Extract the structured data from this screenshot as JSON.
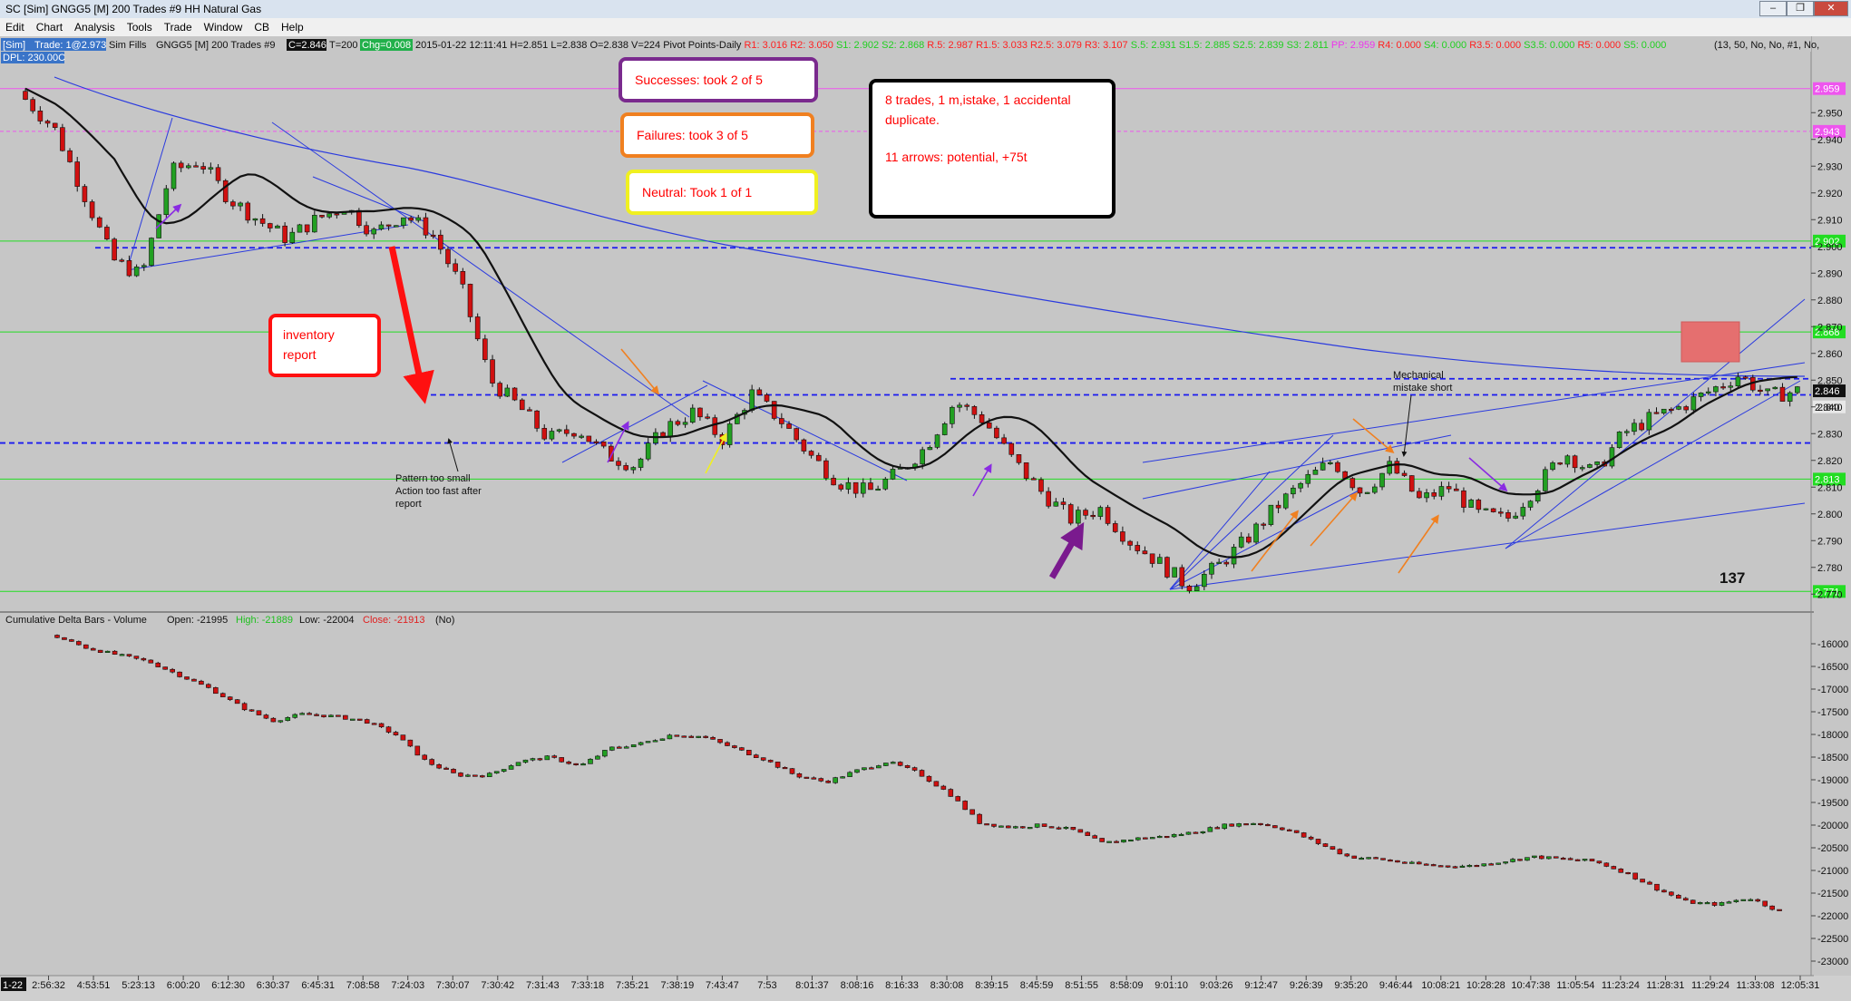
{
  "window": {
    "title": "SC [Sim] GNGG5 [M]  200 Trades  #9  HH Natural Gas",
    "buttons": [
      "–",
      "❐",
      "✕"
    ]
  },
  "menu": [
    "Edit",
    "Chart",
    "Analysis",
    "Tools",
    "Trade",
    "Window",
    "CB",
    "Help"
  ],
  "infobar": {
    "sim_tag": "[Sim]",
    "trade_tag": "Trade: 1@2.973",
    "fills": "Sim Fills",
    "symbol": "GNGG5 [M]  200 Trades  #9",
    "last_box": "C=2.846",
    "trades": "T=200",
    "chg_box": "Chg=0.008",
    "ohlc": "2015-01-22 12:11:41  H=2.851  L=2.838  O=2.838  V=224  Pivot Points-Daily",
    "pivots_red": "R1: 3.016  R2: 3.050  ",
    "pivots_green1": "S1: 2.902  S2: 2.868  ",
    "pivots_red2": "R.5: 2.987  R1.5: 3.033  R2.5: 3.079  R3: 3.107  ",
    "pivots_green2": "S.5: 2.931  S1.5: 2.885  S2.5: 2.839  S3: 2.811  ",
    "pp": "PP: 2.959  ",
    "pivots_red3": "R4: 0.000  ",
    "pivots_green3": "S4: 0.000  ",
    "pivots_red4": "R3.5: 0.000  ",
    "pivots_green4": "S3.5: 0.000  ",
    "pivots_red5": "R5: 0.000  ",
    "pivots_green5": "S5: 0.000",
    "study_params": "(13, 50, No, No, #1, No,",
    "dpl": "DPL: 230.00C"
  },
  "lower_header": {
    "name": "Cumulative Delta Bars - Volume",
    "open": "Open: -21995",
    "high": "High: -21889",
    "low": "Low: -22004",
    "close": "Close: -21913",
    "flag": "(No)"
  },
  "notes": {
    "successes": "Successes: took 2 of 5",
    "failures": "Failures: took 3 of 5",
    "neutral": "Neutral: Took 1 of 1",
    "summary_line1": "8 trades, 1 m,istake, 1 accidental",
    "summary_line2": "duplicate.",
    "summary_line3": "11 arrows: potential,  +75t",
    "inventory_line1": "inventory",
    "inventory_line2": "report",
    "pattern_line1": "Pattern too small",
    "pattern_line2": "Action too fast after",
    "pattern_line3": "report",
    "mechanical_line1": "Mechanical",
    "mechanical_line2": "mistake short",
    "count": "137"
  },
  "colors": {
    "background": "#c6c6c6",
    "up_bar": "#22a022",
    "down_bar": "#d01010",
    "pivot_green": "#22dd22",
    "dashed_level": "#1a1af0",
    "magenta_level": "#ee55ee",
    "trendline": "#2a3adf",
    "successes_border": "#7a2a8e",
    "failures_border": "#f08020",
    "neutral_border": "#f0f020",
    "inventory_border": "#ff1010",
    "summary_border": "#000000",
    "note_text": "#ff0000"
  },
  "chart_data": {
    "type": "candlestick",
    "price": {
      "ylim": [
        2.765,
        2.965
      ],
      "y_ticks": [
        2.95,
        2.94,
        2.93,
        2.92,
        2.91,
        2.9,
        2.89,
        2.88,
        2.87,
        2.86,
        2.85,
        2.84,
        2.83,
        2.82,
        2.81,
        2.8,
        2.79,
        2.78,
        2.77
      ],
      "y_tick_labels": [
        "2.950",
        "2.940",
        "2.930",
        "2.920",
        "2.910",
        "2.900",
        "2.890",
        "2.880",
        "2.870",
        "2.860",
        "2.850",
        "2.840",
        "2.830",
        "2.820",
        "2.810",
        "2.800",
        "2.790",
        "2.780",
        "2.770"
      ],
      "close_keypoints": [
        2.955,
        2.944,
        2.92,
        2.895,
        2.889,
        2.928,
        2.932,
        2.918,
        2.91,
        2.903,
        2.91,
        2.915,
        2.905,
        2.912,
        2.905,
        2.885,
        2.85,
        2.84,
        2.828,
        2.832,
        2.822,
        2.818,
        2.832,
        2.838,
        2.828,
        2.845,
        2.835,
        2.822,
        2.812,
        2.808,
        2.815,
        2.825,
        2.842,
        2.835,
        2.82,
        2.808,
        2.798,
        2.802,
        2.79,
        2.782,
        2.773,
        2.78,
        2.79,
        2.802,
        2.812,
        2.82,
        2.808,
        2.818,
        2.805,
        2.81,
        2.8,
        2.798,
        2.81,
        2.823,
        2.815,
        2.83,
        2.836,
        2.84,
        2.846,
        2.852,
        2.844,
        2.846
      ],
      "levels": [
        {
          "name": "PP",
          "value": 2.959,
          "label": "2.959",
          "style": "magenta"
        },
        {
          "name": "R.5-area",
          "value": 2.943,
          "label": "2.943",
          "style": "magenta-dashed"
        },
        {
          "name": "S1",
          "value": 2.902,
          "label": "2.902",
          "style": "green"
        },
        {
          "name": "S1.5",
          "value": 2.868,
          "label": "2.868",
          "style": "green"
        },
        {
          "name": "S2",
          "value": 2.813,
          "label": "2.813",
          "style": "green"
        },
        {
          "name": "S3",
          "value": 2.771,
          "label": "2.771",
          "style": "green"
        },
        {
          "name": "dash1",
          "value": 2.8995,
          "label": "",
          "style": "dashed"
        },
        {
          "name": "dash2",
          "value": 2.8505,
          "label": "",
          "style": "dashed"
        },
        {
          "name": "dash3",
          "value": 2.8445,
          "label": "",
          "style": "dashed"
        },
        {
          "name": "dash4",
          "value": 2.8265,
          "label": "",
          "style": "dashed"
        }
      ],
      "last_price": {
        "value": 2.846,
        "label": "2.846"
      },
      "prev_close": {
        "value": 2.84,
        "label": "2.840"
      }
    },
    "delta": {
      "ylim": [
        -23200,
        -15700
      ],
      "y_ticks": [
        -16000,
        -16500,
        -17000,
        -17500,
        -18000,
        -18500,
        -19000,
        -19500,
        -20000,
        -20500,
        -21000,
        -21500,
        -22000,
        -22500,
        -23000
      ],
      "y_tick_labels": [
        "-16000",
        "-16500",
        "-17000",
        "-17500",
        "-18000",
        "-18500",
        "-19000",
        "-19500",
        "-20000",
        "-20500",
        "-21000",
        "-21500",
        "-22000",
        "-22500",
        "-23000"
      ],
      "close_keypoints": [
        -15850,
        -16100,
        -16250,
        -16400,
        -16700,
        -17000,
        -17400,
        -17700,
        -17550,
        -17600,
        -17700,
        -18000,
        -18600,
        -18900,
        -18900,
        -18600,
        -18500,
        -18700,
        -18300,
        -18200,
        -18000,
        -18050,
        -18300,
        -18550,
        -18900,
        -19050,
        -18800,
        -18600,
        -18850,
        -19300,
        -19950,
        -20050,
        -20000,
        -20100,
        -20400,
        -20300,
        -20250,
        -20150,
        -20000,
        -19950,
        -20100,
        -20400,
        -20700,
        -20750,
        -20850,
        -20900,
        -20900,
        -20800,
        -20700,
        -20750,
        -20800,
        -21050,
        -21400,
        -21700,
        -21750,
        -21600,
        -21900
      ]
    },
    "x_tick_labels": [
      "1-22",
      "2:56:32",
      "4:53:51",
      "5:23:13",
      "6:00:20",
      "6:12:30",
      "6:30:37",
      "6:45:31",
      "7:08:58",
      "7:24:03",
      "7:30:07",
      "7:30:42",
      "7:31:43",
      "7:33:18",
      "7:35:21",
      "7:38:19",
      "7:43:47",
      "7:53",
      "8:01:37",
      "8:08:16",
      "8:16:33",
      "8:30:08",
      "8:39:15",
      "8:45:59",
      "8:51:55",
      "8:58:09",
      "9:01:10",
      "9:03:26",
      "9:12:47",
      "9:26:39",
      "9:35:20",
      "9:46:44",
      "10:08:21",
      "10:28:28",
      "10:47:38",
      "11:05:54",
      "11:23:24",
      "11:28:31",
      "11:29:24",
      "11:33:08",
      "12:05:31"
    ]
  }
}
